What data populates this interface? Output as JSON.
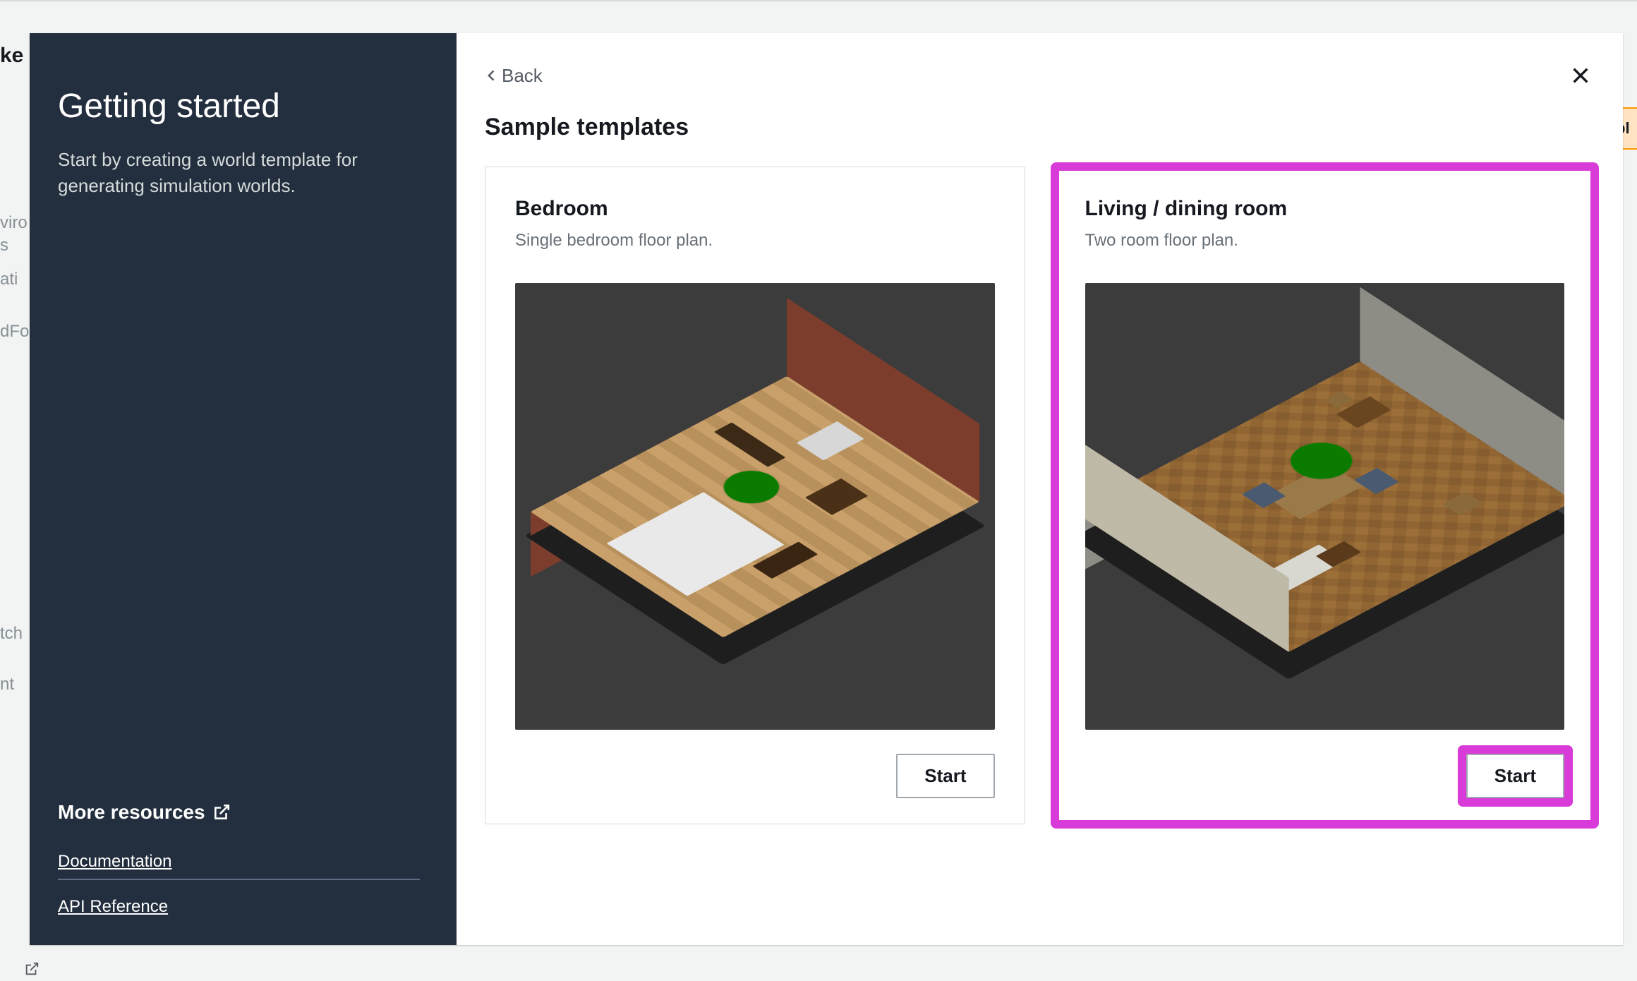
{
  "background": {
    "fragments": [
      "ke",
      "viro",
      "s",
      "ati",
      "dFo",
      "tch",
      "nt"
    ],
    "orange_fragment": "pl"
  },
  "sidebar": {
    "title": "Getting started",
    "subtitle": "Start by creating a world template for generating simulation worlds.",
    "more_resources_label": "More resources",
    "links": [
      {
        "label": "Documentation"
      },
      {
        "label": "API Reference"
      }
    ]
  },
  "main": {
    "back_label": "Back",
    "section_title": "Sample templates",
    "templates": [
      {
        "title": "Bedroom",
        "description": "Single bedroom floor plan.",
        "start_label": "Start",
        "highlighted": false
      },
      {
        "title": "Living / dining room",
        "description": "Two room floor plan.",
        "start_label": "Start",
        "highlighted": true
      }
    ]
  }
}
